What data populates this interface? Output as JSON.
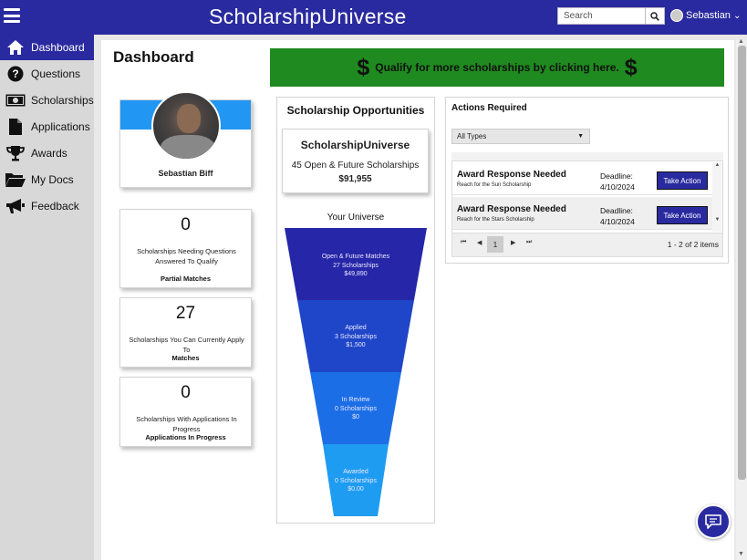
{
  "header": {
    "title": "ScholarshipUniverse",
    "search_placeholder": "Search",
    "user_name": "Sebastian"
  },
  "sidebar": {
    "items": [
      {
        "label": "Dashboard",
        "icon": "home-icon",
        "active": true
      },
      {
        "label": "Questions",
        "icon": "question-icon"
      },
      {
        "label": "Scholarships",
        "icon": "money-icon"
      },
      {
        "label": "Applications",
        "icon": "document-icon"
      },
      {
        "label": "Awards",
        "icon": "trophy-icon"
      },
      {
        "label": "My Docs",
        "icon": "folder-icon"
      },
      {
        "label": "Feedback",
        "icon": "megaphone-icon"
      }
    ]
  },
  "page": {
    "title": "Dashboard",
    "banner": "Qualify for more scholarships by clicking here.",
    "banner_symbol": "$"
  },
  "profile": {
    "name": "Sebastian Biff"
  },
  "stats": [
    {
      "value": "0",
      "desc": "Scholarships Needing Questions Answered To Qualify",
      "link": "Partial Matches"
    },
    {
      "value": "27",
      "desc": "Scholarships You Can Currently Apply To",
      "link": "Matches"
    },
    {
      "value": "0",
      "desc": "Scholarships With Applications In Progress",
      "link": "Applications In Progress"
    }
  ],
  "opportunities": {
    "title": "Scholarship Opportunities",
    "brand": "ScholarshipUniverse",
    "count_text": "45 Open & Future Scholarships",
    "amount": "$91,955",
    "universe_title": "Your Universe",
    "funnel": [
      {
        "name": "Open & Future Matches",
        "count": "27 Scholarships",
        "amount": "$49,890",
        "color": "#2626a8"
      },
      {
        "name": "Applied",
        "count": "3 Scholarships",
        "amount": "$1,500",
        "color": "#1f46c8"
      },
      {
        "name": "In Review",
        "count": "0 Scholarships",
        "amount": "$0",
        "color": "#1c6ee6"
      },
      {
        "name": "Awarded",
        "count": "0 Scholarships",
        "amount": "$0.00",
        "color": "#1e9cf2"
      }
    ]
  },
  "actions": {
    "title": "Actions Required",
    "filter": "All Types",
    "rows": [
      {
        "title": "Award Response Needed",
        "sub": "Reach for the Sun Scholarship",
        "deadline_label": "Deadline:",
        "deadline": "4/10/2024",
        "button": "Take Action"
      },
      {
        "title": "Award Response Needed",
        "sub": "Reach for the Stars Scholarship",
        "deadline_label": "Deadline:",
        "deadline": "4/10/2024",
        "button": "Take Action"
      }
    ],
    "pager": {
      "current": "1",
      "info": "1 - 2 of 2 items"
    }
  },
  "colors": {
    "primary": "#2a2aa0",
    "banner": "#1f8a1f",
    "profile_band": "#2196f3",
    "sidebar": "#d8d8d8"
  }
}
